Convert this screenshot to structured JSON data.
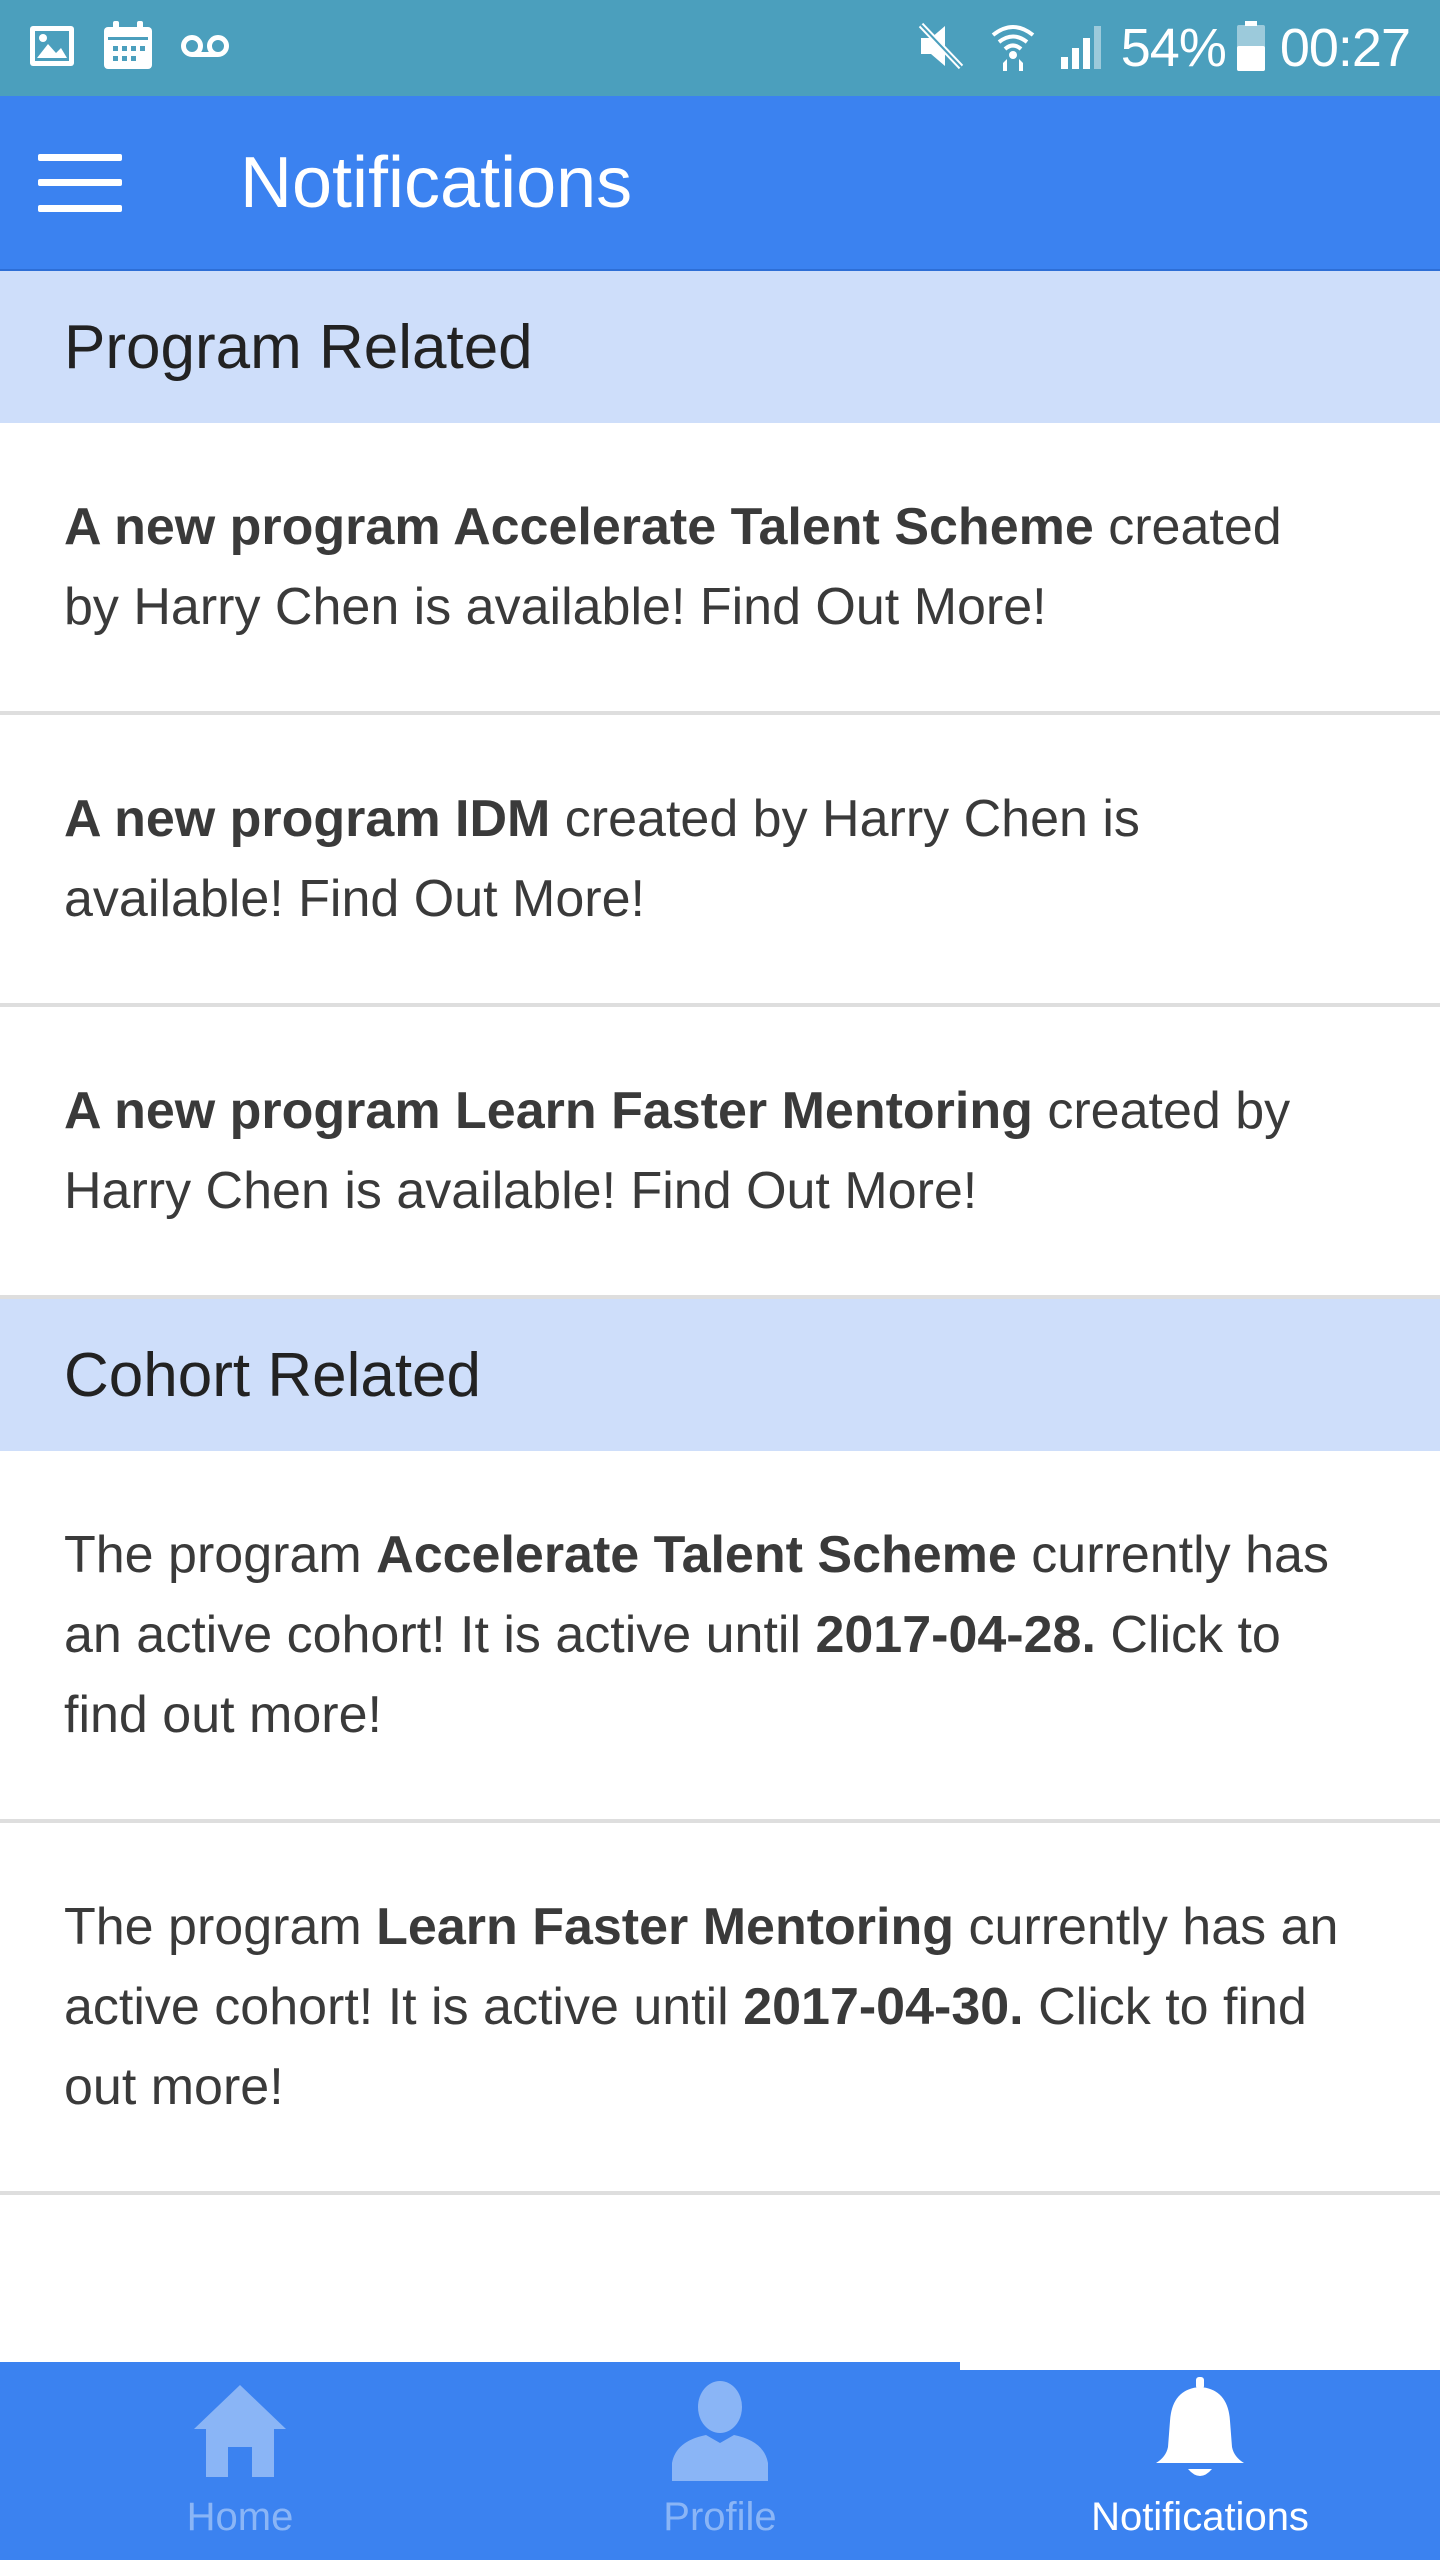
{
  "status_bar": {
    "icons": [
      "image-icon",
      "calendar-icon",
      "voicemail-icon",
      "mute-icon",
      "wifi-icon",
      "signal-icon",
      "battery-icon"
    ],
    "battery": "54%",
    "time": "00:27"
  },
  "app_bar": {
    "title": "Notifications",
    "menu_icon": "hamburger-icon"
  },
  "sections": {
    "program": {
      "title": "Program Related",
      "items": [
        {
          "bold": "A new program Accelerate Talent Scheme",
          "rest": " created by Harry Chen is available! Find Out More!"
        },
        {
          "bold": "A new program IDM",
          "rest": " created by Harry Chen is available! Find Out More!"
        },
        {
          "bold": "A new program Learn Faster Mentoring",
          "rest": " created by Harry Chen is available! Find Out More!"
        }
      ]
    },
    "cohort": {
      "title": "Cohort Related",
      "items": [
        {
          "pre": "The program ",
          "program": "Accelerate Talent Scheme",
          "mid": " currently has an active cohort! It is active until ",
          "date": "2017-04-28.",
          "post": " Click to find out more!"
        },
        {
          "pre": "The program ",
          "program": "Learn Faster Mentoring",
          "mid": " currently has an active cohort! It is active until ",
          "date": "2017-04-30.",
          "post": " Click to find out more!"
        }
      ]
    }
  },
  "bottom_nav": {
    "active": "Notifications",
    "tabs": [
      {
        "label": "Home",
        "icon": "home-icon"
      },
      {
        "label": "Profile",
        "icon": "person-icon"
      },
      {
        "label": "Notifications",
        "icon": "bell-icon"
      }
    ]
  },
  "colors": {
    "status_bar": "#4b9fbd",
    "app_bar": "#3b82f0",
    "section_header": "#cedefa",
    "divider": "#dedede",
    "inactive_tab": "#8ab5f6",
    "active_tab": "#ffffff"
  }
}
